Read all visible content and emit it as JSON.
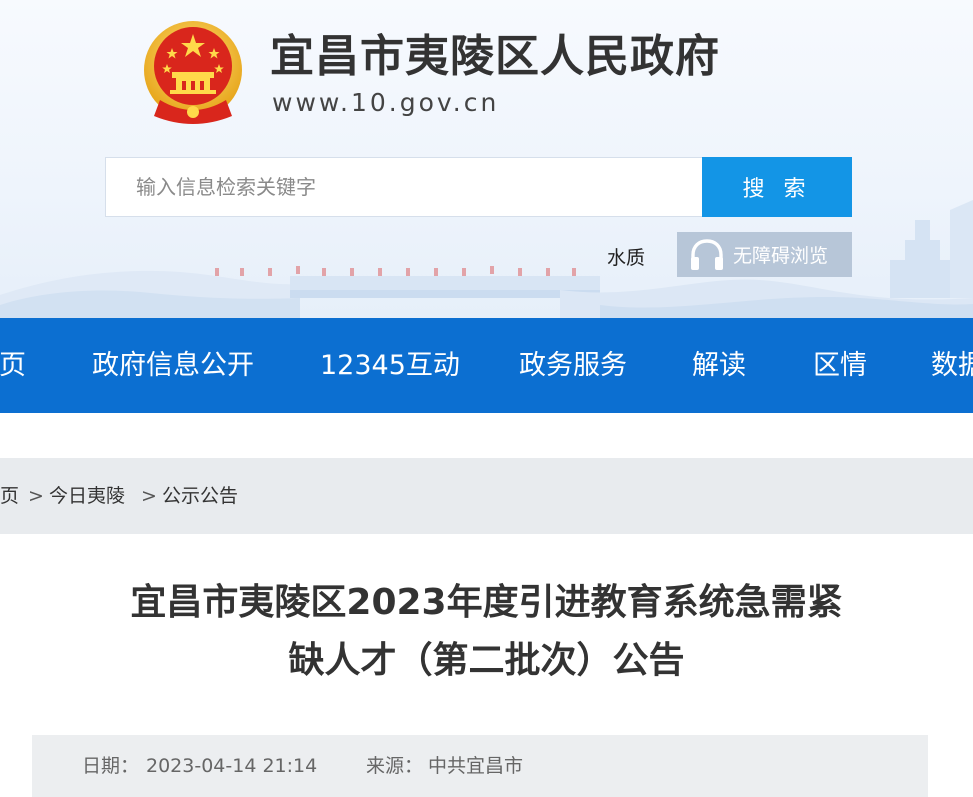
{
  "header": {
    "site_title": "宜昌市夷陵区人民政府",
    "site_url": "www.10.gov.cn",
    "emblem_icon": "national-emblem-icon"
  },
  "search": {
    "placeholder": "输入信息检索关键字",
    "value": "",
    "button_label": "搜 索"
  },
  "tools": {
    "water_link": "水质",
    "accessibility_label": "无障碍浏览",
    "accessibility_icon": "headphones-icon"
  },
  "nav": {
    "items": [
      {
        "label": "页"
      },
      {
        "label": "政府信息公开"
      },
      {
        "label": "12345互动"
      },
      {
        "label": "政务服务"
      },
      {
        "label": "解读"
      },
      {
        "label": "区情"
      },
      {
        "label": "数据"
      }
    ]
  },
  "breadcrumb": {
    "items": [
      "页",
      "今日夷陵",
      "公示公告"
    ],
    "separator": ">"
  },
  "article": {
    "title_line1": "宜昌市夷陵区2023年度引进教育系统急需紧",
    "title_line2": "缺人才（第二批次）公告",
    "date_label": "日期：",
    "date_value": "2023-04-14 21:14",
    "source_label": "来源：",
    "source_value": "中共宜昌市"
  },
  "colors": {
    "nav_bg": "#0c6fd1",
    "search_button": "#1395e6",
    "accessibility_button": "#b7c6d8",
    "breadcrumb_bg": "#e8ebee",
    "meta_bg": "#eceef0"
  }
}
